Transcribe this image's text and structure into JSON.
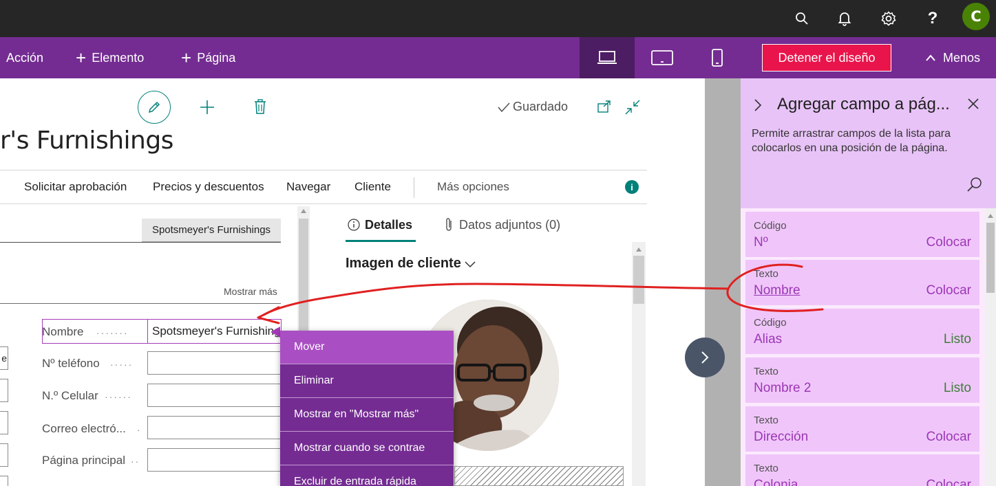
{
  "topbar": {
    "icons": [
      "search-icon",
      "bell-icon",
      "gear-icon",
      "help-icon"
    ],
    "help_glyph": "?",
    "avatar_letter": "C"
  },
  "designbar": {
    "action": "Acción",
    "element": "Elemento",
    "page": "Página",
    "stop_design": "Detener el diseño",
    "less": "Menos",
    "devices": [
      "laptop-icon",
      "tablet-icon",
      "phone-icon"
    ]
  },
  "page": {
    "saved": "Guardado",
    "title": "r's Furnishings",
    "actions": [
      "Solicitar aprobación",
      "Precios y descuentos",
      "Navegar",
      "Cliente",
      "Más opciones"
    ],
    "name_chip": "Spotsmeyer's Furnishings",
    "show_more": "Mostrar más",
    "fields": [
      {
        "label": "Nombre",
        "value": "Spotsmeyer's Furnishings"
      },
      {
        "label": "Nº teléfono",
        "value": ""
      },
      {
        "label": "N.º Celular",
        "value": ""
      },
      {
        "label": "Correo electró...",
        "value": ""
      },
      {
        "label": "Página principal",
        "value": ""
      }
    ],
    "left_box_char": "e"
  },
  "context_menu": {
    "items": [
      "Mover",
      "Eliminar",
      "Mostrar en \"Mostrar más\"",
      "Mostrar cuando se contrae",
      "Excluir de entrada rápida"
    ]
  },
  "details": {
    "tab_details": "Detalles",
    "tab_attachments": "Datos adjuntos (0)",
    "image_heading": "Imagen de cliente"
  },
  "right_pane": {
    "title": "Agregar campo a pág...",
    "description": "Permite arrastrar campos de la lista para colocarlos en una posición de la página.",
    "cards": [
      {
        "type": "Código",
        "name": "Nº",
        "action": "Colocar"
      },
      {
        "type": "Texto",
        "name": "Nombre",
        "action": "Colocar"
      },
      {
        "type": "Código",
        "name": "Alias",
        "action": "Listo"
      },
      {
        "type": "Texto",
        "name": "Nombre 2",
        "action": "Listo"
      },
      {
        "type": "Texto",
        "name": "Dirección",
        "action": "Colocar"
      },
      {
        "type": "Texto",
        "name": "Colonia",
        "action": "Colocar"
      }
    ]
  },
  "colors": {
    "purple": "#742c92",
    "stop_red": "#e8144b",
    "teal": "#00807a",
    "annotation": "#e02020"
  }
}
